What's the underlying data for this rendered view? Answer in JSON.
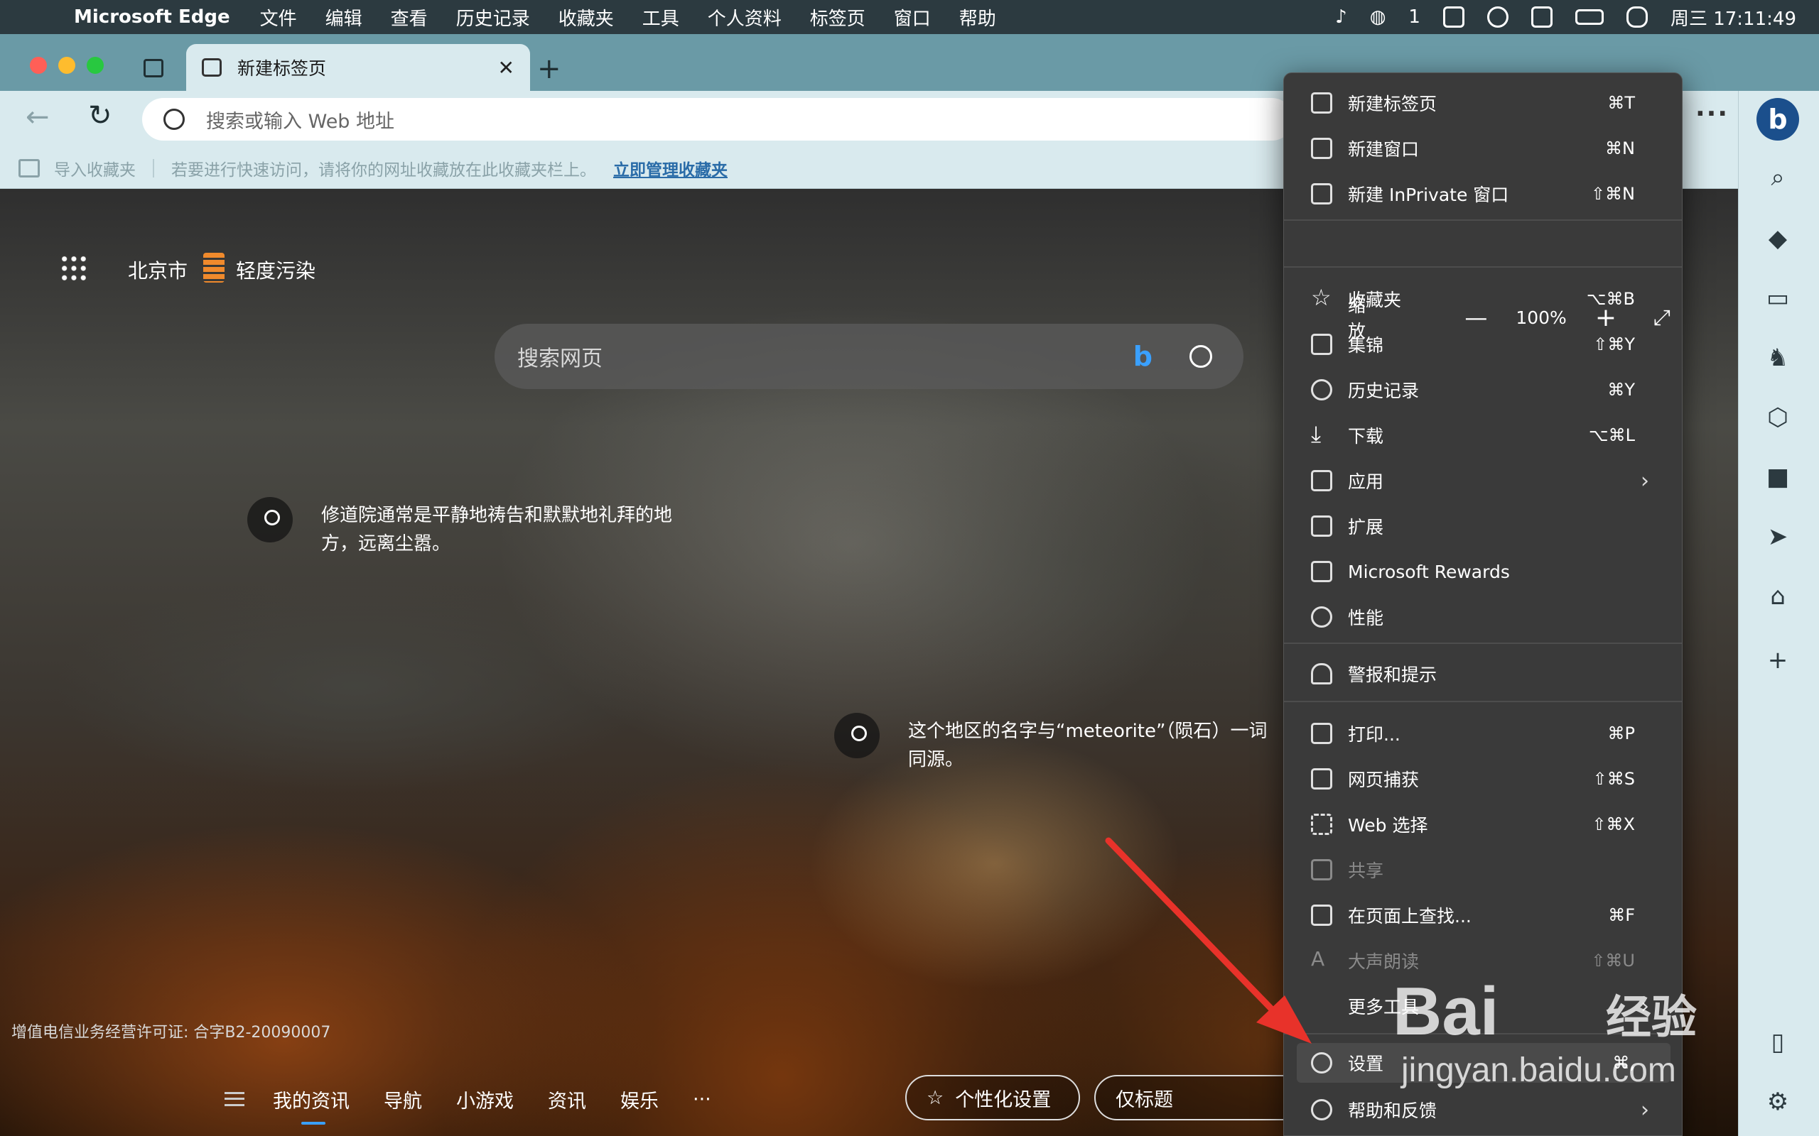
{
  "menubar": {
    "app_name": "Microsoft Edge",
    "items": [
      "文件",
      "编辑",
      "查看",
      "历史记录",
      "收藏夹",
      "工具",
      "个人资料",
      "标签页",
      "窗口",
      "帮助"
    ],
    "wechat_badge": "1",
    "datetime": "周三 17:11:49"
  },
  "tab": {
    "title": "新建标签页"
  },
  "address": {
    "placeholder": "搜索或输入 Web 地址"
  },
  "favbar": {
    "import_label": "导入收藏夹",
    "hint": "若要进行快速访问，请将你的网址收藏放在此收藏夹栏上。",
    "manage_link": "立即管理收藏夹"
  },
  "page": {
    "city": "北京市",
    "air_quality": "轻度污染",
    "search_placeholder": "搜索网页",
    "hotspot1": "修道院通常是平静地祷告和默默地礼拜的地方，远离尘嚣。",
    "hotspot2": "这个地区的名字与“meteorite”（陨石）一词同源。",
    "license": "增值电信业务经营许可证: 合字B2-20090007",
    "feed_nav": [
      "我的资讯",
      "导航",
      "小游戏",
      "资讯",
      "娱乐",
      "···"
    ],
    "personalize": "个性化设置",
    "headlines_only": "仅标题"
  },
  "menu": {
    "items": [
      {
        "label": "新建标签页",
        "shortcut": "⌘T"
      },
      {
        "label": "新建窗口",
        "shortcut": "⌘N"
      },
      {
        "label": "新建 InPrivate 窗口",
        "shortcut": "⇧⌘N"
      },
      {
        "label": "收藏夹",
        "shortcut": "⌥⌘B"
      },
      {
        "label": "集锦",
        "shortcut": "⇧⌘Y"
      },
      {
        "label": "历史记录",
        "shortcut": "⌘Y"
      },
      {
        "label": "下载",
        "shortcut": "⌥⌘L"
      },
      {
        "label": "应用",
        "shortcut": ""
      },
      {
        "label": "扩展",
        "shortcut": ""
      },
      {
        "label": "Microsoft Rewards",
        "shortcut": ""
      },
      {
        "label": "性能",
        "shortcut": ""
      },
      {
        "label": "警报和提示",
        "shortcut": ""
      },
      {
        "label": "打印...",
        "shortcut": "⌘P"
      },
      {
        "label": "网页捕获",
        "shortcut": "⇧⌘S"
      },
      {
        "label": "Web 选择",
        "shortcut": "⇧⌘X"
      },
      {
        "label": "共享",
        "shortcut": ""
      },
      {
        "label": "在页面上查找...",
        "shortcut": "⌘F"
      },
      {
        "label": "大声朗读",
        "shortcut": "⇧⌘U"
      },
      {
        "label": "更多工具",
        "shortcut": ""
      },
      {
        "label": "设置",
        "shortcut": "⌘,"
      },
      {
        "label": "帮助和反馈",
        "shortcut": ""
      }
    ],
    "zoom": {
      "label": "缩放",
      "value": "100%",
      "minus": "—",
      "plus": "+"
    }
  },
  "annotation": {
    "arrow_color": "#e8322a"
  },
  "watermark": {
    "brand": "Bai",
    "brand_cn": "经验",
    "url": "jingyan.baidu.com"
  }
}
